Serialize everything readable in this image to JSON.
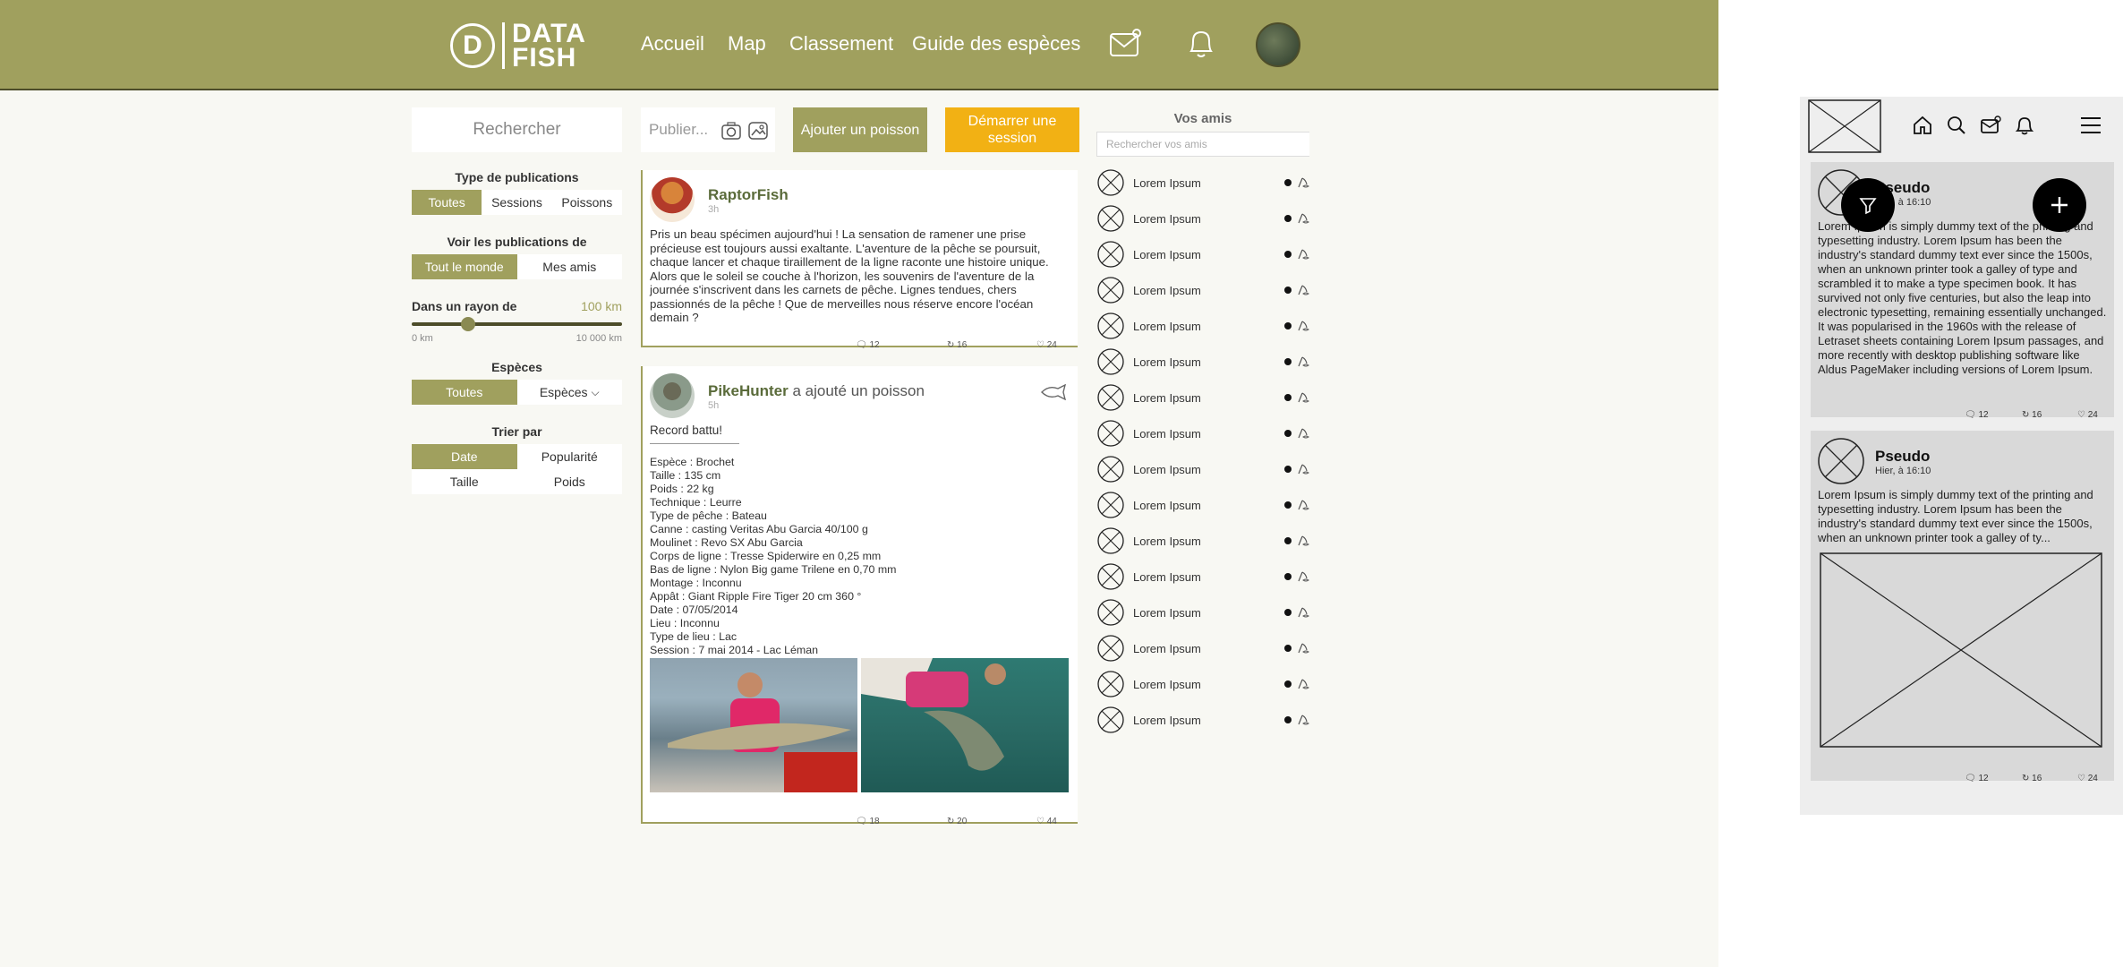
{
  "brand": {
    "logo_letter": "D",
    "logo_line1": "DATA",
    "logo_line2": "FISH"
  },
  "nav": {
    "home": "Accueil",
    "map": "Map",
    "ranking": "Classement",
    "species": "Guide des espèces"
  },
  "sidebar": {
    "search_placeholder": "Rechercher",
    "pub_type": {
      "title": "Type de publications",
      "options": [
        "Toutes",
        "Sessions",
        "Poissons"
      ]
    },
    "see_pubs": {
      "title": "Voir les publications de",
      "options": [
        "Tout le monde",
        "Mes amis"
      ]
    },
    "radius": {
      "title": "Dans un rayon de",
      "value": "100 km",
      "min": "0 km",
      "max": "10 000 km",
      "fraction": 0.27
    },
    "species": {
      "title": "Espèces",
      "options": [
        "Toutes",
        "Espèces"
      ]
    },
    "sort": {
      "title": "Trier par",
      "options": [
        "Date",
        "Popularité",
        "Taille",
        "Poids"
      ]
    }
  },
  "composer": {
    "placeholder": "Publier...",
    "add_fish": "Ajouter un poisson",
    "start_session": "Démarrer une session"
  },
  "posts": [
    {
      "author": "RaptorFish",
      "time": "3h",
      "text": "Pris un beau spécimen aujourd'hui ! La sensation de ramener une prise précieuse est toujours aussi exaltante. L'aventure de la pêche se poursuit, chaque lancer et chaque tiraillement de la ligne raconte une histoire unique. Alors que le soleil se couche à l'horizon, les souvenirs de l'aventure de la journée s'inscrivent dans les carnets de pêche. Lignes tendues, chers passionnés de la pêche ! Que de merveilles nous réserve encore l'océan demain ?",
      "comments": "12",
      "shares": "16",
      "likes": "24"
    },
    {
      "author": "PikeHunter",
      "action": "a ajouté un poisson",
      "time": "5h",
      "title": "Record battu!",
      "details": [
        "Espèce : Brochet",
        "Taille : 135 cm",
        "Poids : 22 kg",
        "Technique : Leurre",
        "Type de pêche : Bateau",
        "Canne : casting Veritas Abu Garcia 40/100 g",
        "Moulinet : Revo SX Abu Garcia",
        "Corps de ligne : Tresse Spiderwire en 0,25 mm",
        "Bas de ligne : Nylon Big game Trilene en 0,70 mm",
        "Montage : Inconnu",
        "Appât : Giant Ripple Fire Tiger 20 cm 360 °",
        "Date : 07/05/2014",
        "Lieu : Inconnu",
        "Type de lieu : Lac",
        "Session : 7 mai 2014 - Lac Léman"
      ],
      "comments": "18",
      "shares": "20",
      "likes": "44"
    }
  ],
  "friends": {
    "title": "Vos amis",
    "search_placeholder": "Rechercher vos amis",
    "items": [
      "Lorem Ipsum",
      "Lorem Ipsum",
      "Lorem Ipsum",
      "Lorem Ipsum",
      "Lorem Ipsum",
      "Lorem Ipsum",
      "Lorem Ipsum",
      "Lorem Ipsum",
      "Lorem Ipsum",
      "Lorem Ipsum",
      "Lorem Ipsum",
      "Lorem Ipsum",
      "Lorem Ipsum",
      "Lorem Ipsum",
      "Lorem Ipsum",
      "Lorem Ipsum"
    ]
  },
  "mobile": {
    "cards": [
      {
        "pseudo": "Pseudo",
        "time": "Hier, à 16:10",
        "text": "Lorem Ipsum is simply dummy text of the printing and typesetting industry. Lorem Ipsum has been the industry's standard dummy text ever since the 1500s, when an unknown printer took a galley of type and scrambled it to make a type specimen book. It has survived not only five centuries, but also the leap into electronic typesetting, remaining essentially unchanged. It was popularised in the 1960s with the release of Letraset sheets containing Lorem Ipsum passages, and more recently with desktop publishing software like Aldus PageMaker including versions of Lorem Ipsum.",
        "comments": "12",
        "shares": "16",
        "likes": "24"
      },
      {
        "pseudo": "Pseudo",
        "time": "Hier, à 16:10",
        "text": "Lorem Ipsum is simply dummy text of the printing and typesetting industry. Lorem Ipsum has been the industry's standard dummy text ever since the 1500s, when an unknown printer took a galley of ty...",
        "comments": "12",
        "shares": "16",
        "likes": "24"
      }
    ]
  },
  "colors": {
    "brand": "#a0a05e",
    "accent": "#f2b114",
    "background": "#f8f8f3"
  }
}
